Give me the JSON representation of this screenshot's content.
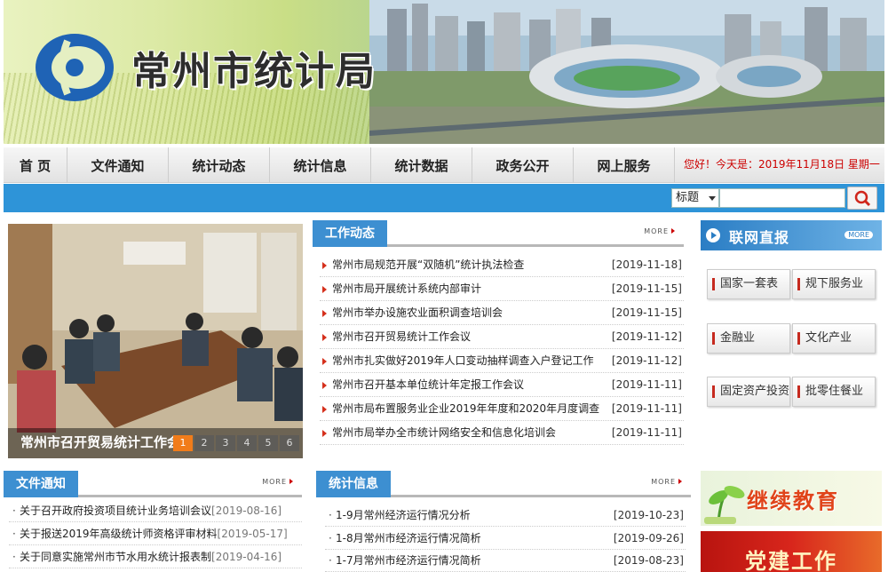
{
  "header": {
    "site_title": "常州市统计局"
  },
  "nav": {
    "items": [
      "首 页",
      "文件通知",
      "统计动态",
      "统计信息",
      "统计数据",
      "政务公开",
      "网上服务"
    ],
    "date_text": "您好！今天是：2019年11月18日 星期一"
  },
  "search": {
    "select_value": "标题",
    "placeholder": ""
  },
  "slideshow": {
    "caption": "常州市召开贸易统计工作会议",
    "pages": [
      "1",
      "2",
      "3",
      "4",
      "5",
      "6"
    ],
    "active_page": "1"
  },
  "work_news": {
    "title": "工作动态",
    "more": "MORE",
    "items": [
      {
        "title": "常州市局规范开展“双随机”统计执法检查",
        "date": "[2019-11-18]"
      },
      {
        "title": "常州市局开展统计系统内部审计",
        "date": "[2019-11-15]"
      },
      {
        "title": "常州市举办设施农业面积调查培训会",
        "date": "[2019-11-15]"
      },
      {
        "title": "常州市召开贸易统计工作会议",
        "date": "[2019-11-12]"
      },
      {
        "title": "常州市扎实做好2019年人口变动抽样调查入户登记工作",
        "date": "[2019-11-12]"
      },
      {
        "title": "常州市召开基本单位统计年定报工作会议",
        "date": "[2019-11-11]"
      },
      {
        "title": "常州市局布置服务业企业2019年年度和2020年月度调查",
        "date": "[2019-11-11]"
      },
      {
        "title": "常州市局举办全市统计网络安全和信息化培训会",
        "date": "[2019-11-11]"
      }
    ]
  },
  "live": {
    "title": "联网直报",
    "more": "MORE",
    "buttons": [
      "国家一套表",
      "规下服务业",
      "金融业",
      "文化产业",
      "固定资产投资",
      "批零住餐业"
    ]
  },
  "file_notice": {
    "title": "文件通知",
    "more": "MORE",
    "items": [
      {
        "title": "关于召开政府投资项目统计业务培训会议",
        "date": "[2019-08-16]"
      },
      {
        "title": "关于报送2019年高级统计师资格评审材料",
        "date": "[2019-05-17]"
      },
      {
        "title": "关于同意实施常州市节水用水统计报表制",
        "date": "[2019-04-16]"
      }
    ]
  },
  "stat_info": {
    "title": "统计信息",
    "more": "MORE",
    "items": [
      {
        "title": "1-9月常州经济运行情况分析",
        "date": "[2019-10-23]"
      },
      {
        "title": "1-8月常州市经济运行情况简析",
        "date": "[2019-09-26]"
      },
      {
        "title": "1-7月常州市经济运行情况简析",
        "date": "[2019-08-23]"
      }
    ]
  },
  "promos": [
    "继续教育",
    "党建工作"
  ],
  "colors": {
    "accent_blue": "#2e94d8",
    "tab_blue": "#3d8fd1",
    "bullet_red": "#d5301c",
    "slide_active": "#f17c1a"
  }
}
